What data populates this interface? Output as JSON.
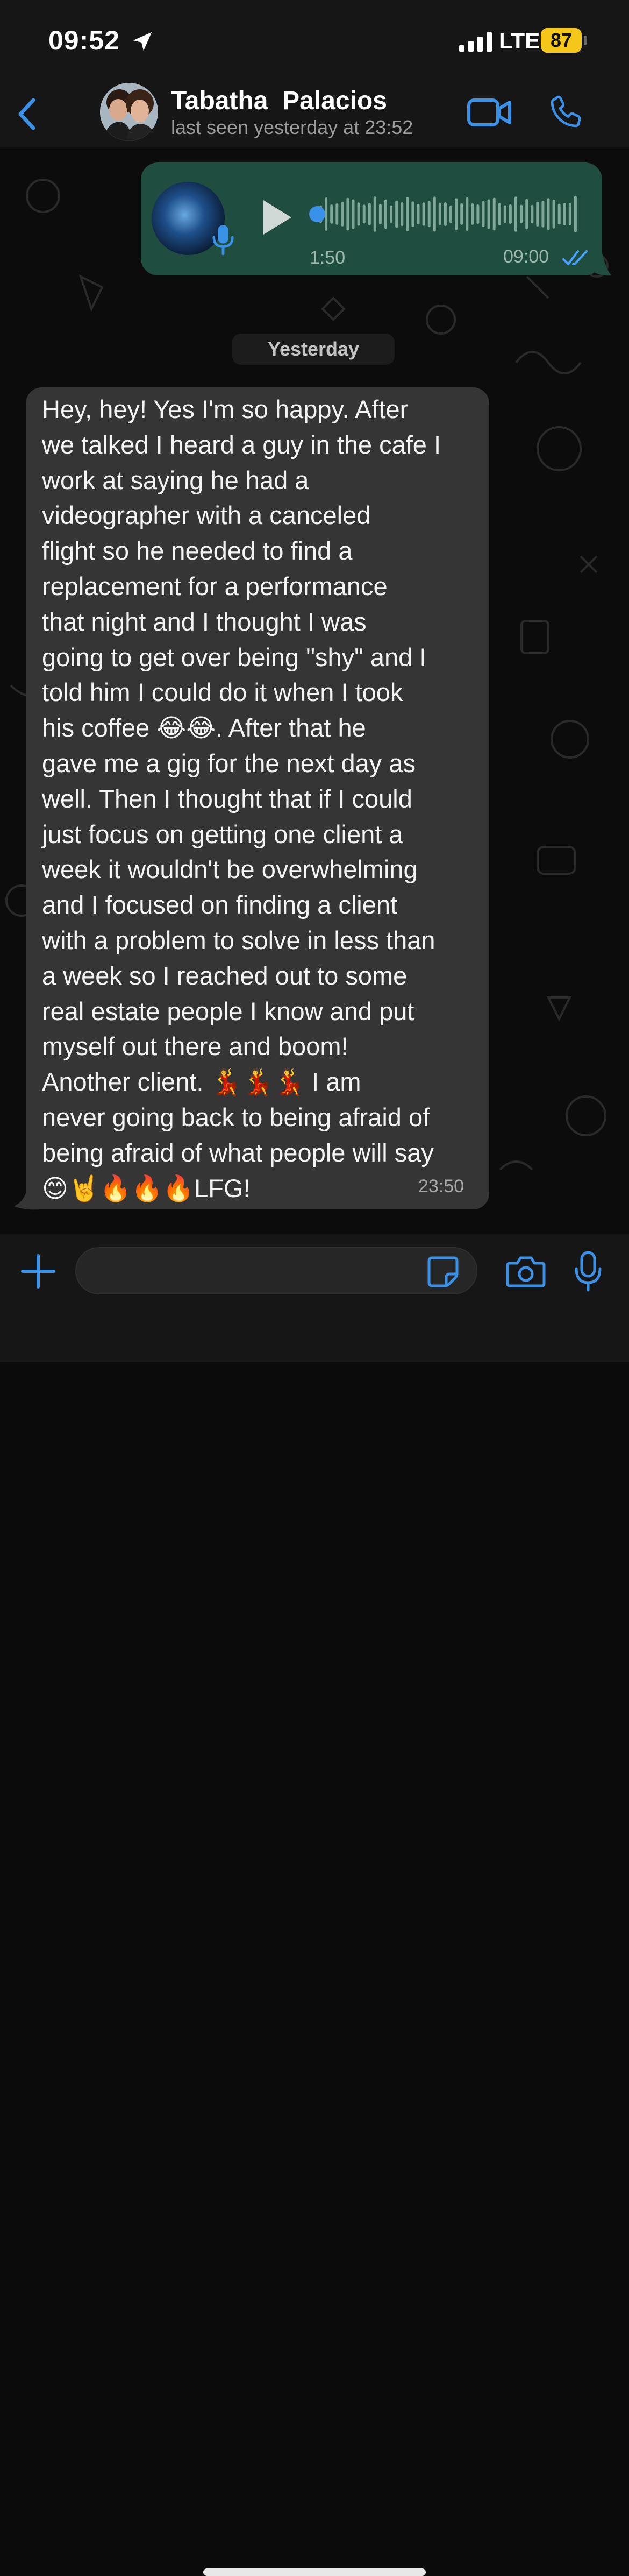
{
  "status_bar": {
    "time": "09:52",
    "network": "LTE",
    "battery": "87"
  },
  "header": {
    "contact_name": "Tabatha  Palacios",
    "last_seen": "last seen yesterday at 23:52"
  },
  "voice_message": {
    "duration": "1:50",
    "time": "09:00",
    "progress": 0
  },
  "date_divider": "Yesterday",
  "incoming_message": {
    "lines": [
      "Hey, hey! Yes I'm so happy. After",
      "we talked I heard a guy in the cafe I",
      "work at saying he had a",
      "videographer with a canceled",
      "flight so he needed to find a",
      "replacement for a performance",
      "that night and I thought I was",
      "going to get over being \"shy\" and I",
      "told him I could do it when I took",
      "his coffee 😂😂. After that he",
      "gave me a gig for the next day as",
      "well. Then I thought that if I could",
      "just focus on getting one client a",
      "week it wouldn't be overwhelming",
      "and I focused on finding a client",
      "with a problem to solve in less than",
      "a week so I reached out to some",
      "real  estate people I know and put",
      "myself out there and boom!",
      "Another client. 💃💃💃 I am",
      "never going back to being afraid of",
      "being afraid of what people will say",
      "😊🤘🔥🔥🔥LFG!"
    ],
    "time": "23:50"
  },
  "composer": {
    "value": "",
    "placeholder": ""
  },
  "colors": {
    "accent": "#3a91e8",
    "outgoing_bubble": "#1f4d3f",
    "incoming_bubble": "#353535",
    "battery": "#f5c71a"
  },
  "icons": [
    "location-arrow-icon",
    "signal-icon",
    "battery-icon",
    "back-chevron-icon",
    "video-call-icon",
    "phone-icon",
    "play-icon",
    "microphone-icon",
    "double-check-icon",
    "plus-icon",
    "sticker-icon",
    "camera-icon"
  ]
}
